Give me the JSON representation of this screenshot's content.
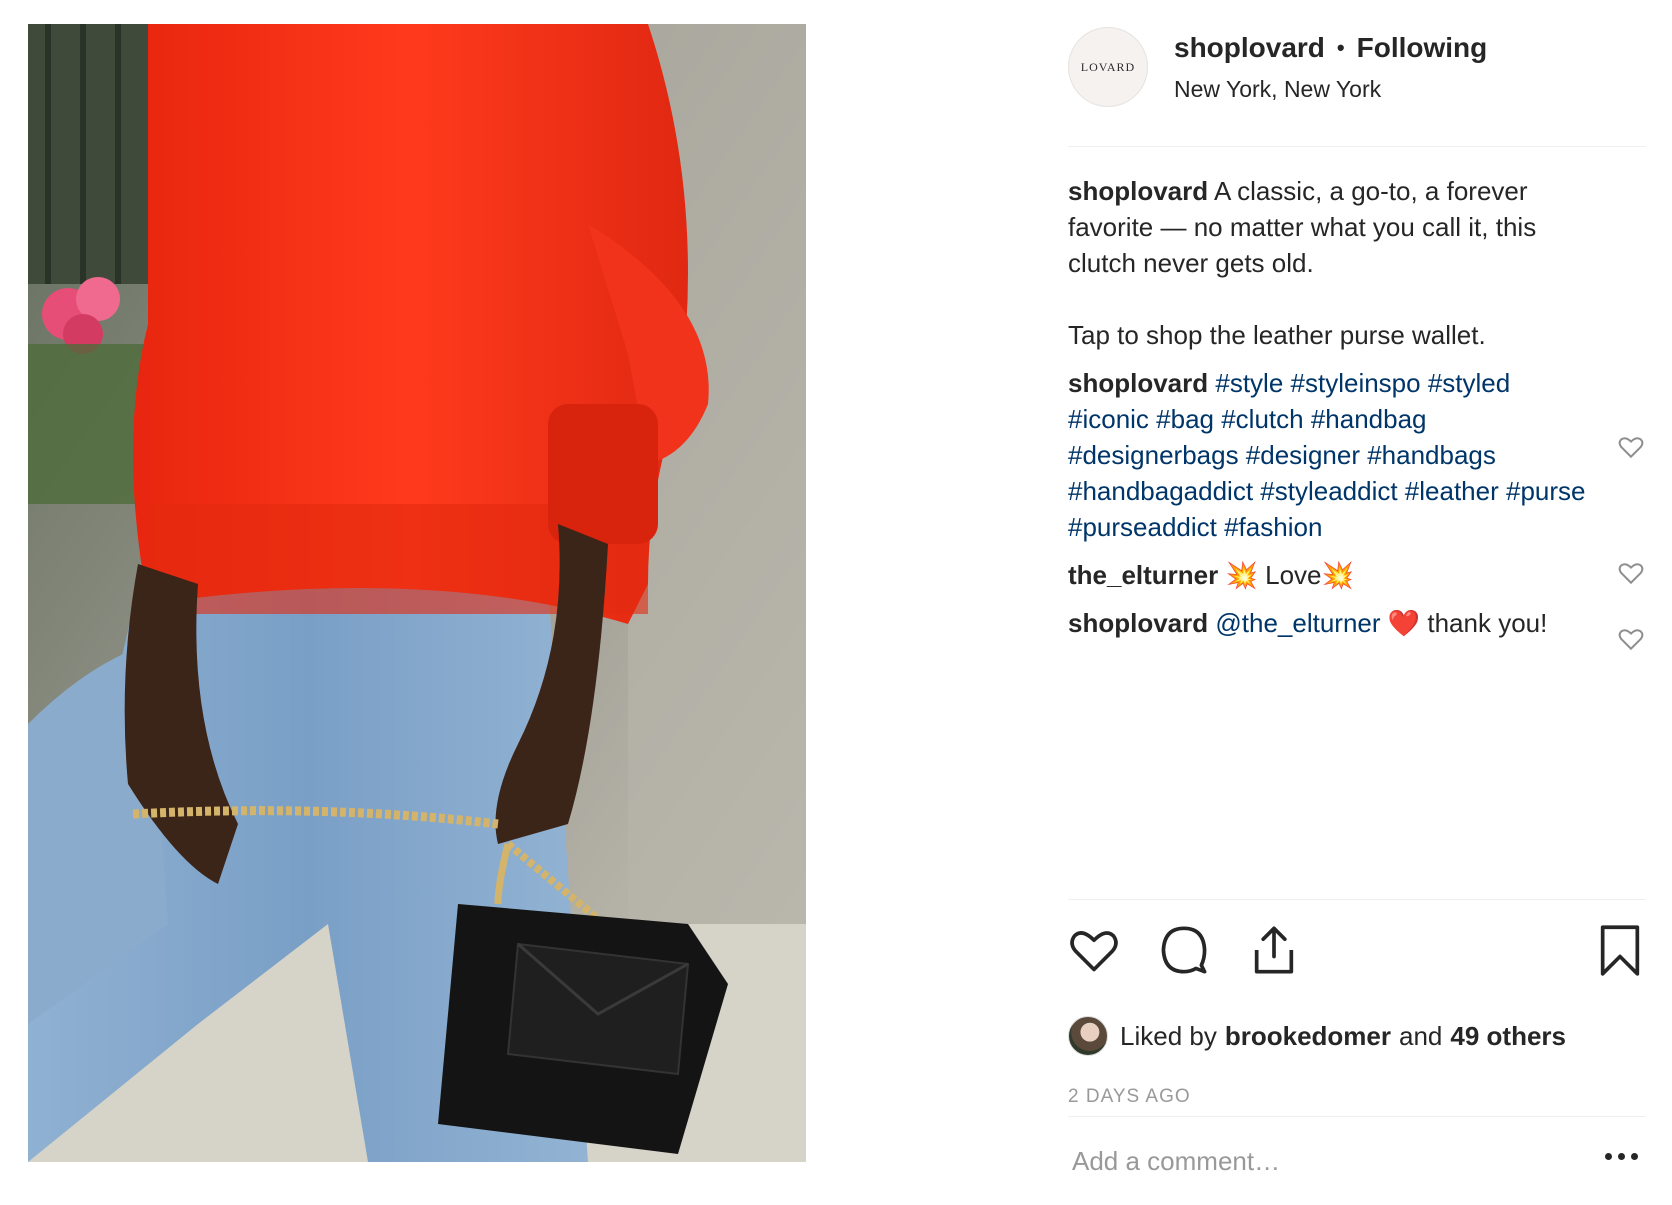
{
  "post": {
    "image_alt": "Person in red sweatshirt and jeans holding a black leather clutch with gold chain",
    "colors": {
      "sweater": "#ff2f14",
      "jeans": "#7fa3c8",
      "bag": "#141414",
      "chain": "#d4b46a",
      "hashtag": "#003569",
      "muted": "#999999"
    }
  },
  "header": {
    "avatar_text": "LOVARD",
    "username": "shoplovard",
    "separator": "•",
    "follow_status": "Following",
    "location": "New York, New York"
  },
  "comments": [
    {
      "user": "shoplovard",
      "text": "A classic, a go-to, a forever favorite — no matter what you call it, this clutch never gets old.",
      "text2": "Tap to shop the leather purse wallet."
    },
    {
      "user": "shoplovard",
      "hashtags": "#style #styleinspo #styled #iconic #bag #clutch #handbag #designerbags #designer #handbags #handbagaddict #styleaddict #leather #purse #purseaddict #fashion"
    },
    {
      "user": "the_elturner",
      "emoji1": "💥",
      "text": "Love",
      "emoji2": "💥"
    },
    {
      "user": "shoplovard",
      "mention": "@the_elturner",
      "emoji": "❤️",
      "text": "thank you!"
    }
  ],
  "actions": {
    "like_icon": "heart-icon",
    "comment_icon": "speech-bubble-icon",
    "share_icon": "share-upload-icon",
    "save_icon": "bookmark-icon"
  },
  "likes": {
    "prefix": "Liked by",
    "user": "brookedomer",
    "conjunction": "and",
    "others": "49 others"
  },
  "timestamp": "2 DAYS AGO",
  "add_comment": {
    "placeholder": "Add a comment…"
  }
}
